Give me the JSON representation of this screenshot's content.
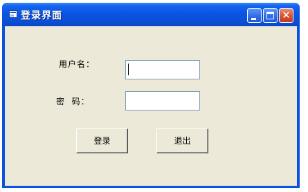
{
  "window": {
    "title": "登录界面",
    "titlebar_color": "#0A55E3",
    "client_color": "#ECE9D8",
    "controls": {
      "minimize_icon": "minimize-icon",
      "maximize_icon": "maximize-icon",
      "close_icon": "close-icon",
      "close_glyph": "✕"
    }
  },
  "form": {
    "username_label": "用户名：",
    "username_value": "",
    "password_label": "密  码：",
    "password_value": ""
  },
  "buttons": {
    "login": "登录",
    "exit": "退出"
  }
}
